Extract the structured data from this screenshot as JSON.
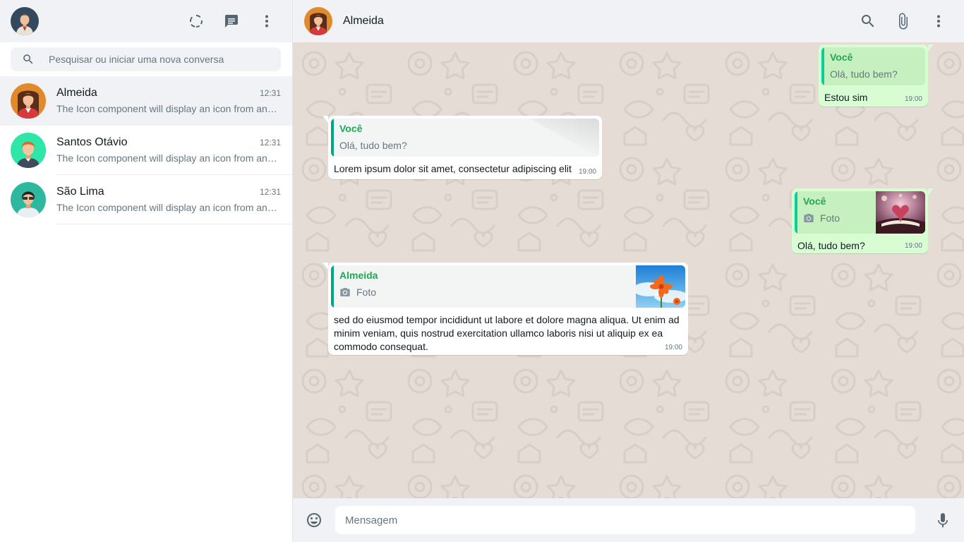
{
  "sidebar": {
    "search": {
      "placeholder": "Pesquisar ou iniciar uma nova conversa"
    },
    "icons": [
      "status-icon",
      "new-chat-icon",
      "menu-icon"
    ],
    "chats": [
      {
        "name": "Almeida",
        "time": "12:31",
        "preview": "The Icon component will display an icon from any…",
        "active": true
      },
      {
        "name": "Santos Otávio",
        "time": "12:31",
        "preview": "The Icon component will display an icon from any…",
        "active": false
      },
      {
        "name": "São Lima",
        "time": "12:31",
        "preview": "The Icon component will display an icon from any…",
        "active": false
      }
    ]
  },
  "conversation": {
    "contact_name": "Almeida",
    "icons": [
      "search-icon",
      "attach-icon",
      "menu-icon"
    ],
    "messages": [
      {
        "direction": "out",
        "quote_author": "Você",
        "quote_text": "Olá, tudo bem?",
        "text": "Estou sim",
        "time": "19:00"
      },
      {
        "direction": "in",
        "quote_author": "Você",
        "quote_text": "Olá, tudo bem?",
        "text": "Lorem ipsum dolor sit amet, consectetur adipiscing elit",
        "time": "19:00"
      },
      {
        "direction": "out",
        "quote_author": "Você",
        "quote_text": "Foto",
        "quote_has_photo": true,
        "text": "Olá, tudo bem?",
        "time": "19:00"
      },
      {
        "direction": "in",
        "quote_author": "Almeida",
        "quote_text": "Foto",
        "quote_has_photo": true,
        "text": "sed do eiusmod tempor incididunt ut labore et dolore magna aliqua. Ut enim ad minim veniam, quis nostrud exercitation ullamco laboris nisi ut aliquip ex ea commodo consequat.",
        "time": "19:00"
      }
    ]
  },
  "composer": {
    "placeholder": "Mensagem"
  },
  "colors": {
    "header_bg": "#f0f2f5",
    "chat_bg": "#e5ddd5",
    "outgoing_bubble": "#d9fdd3",
    "incoming_bubble": "#ffffff",
    "accent": "#00a884",
    "quote_author": "#1fa855"
  }
}
